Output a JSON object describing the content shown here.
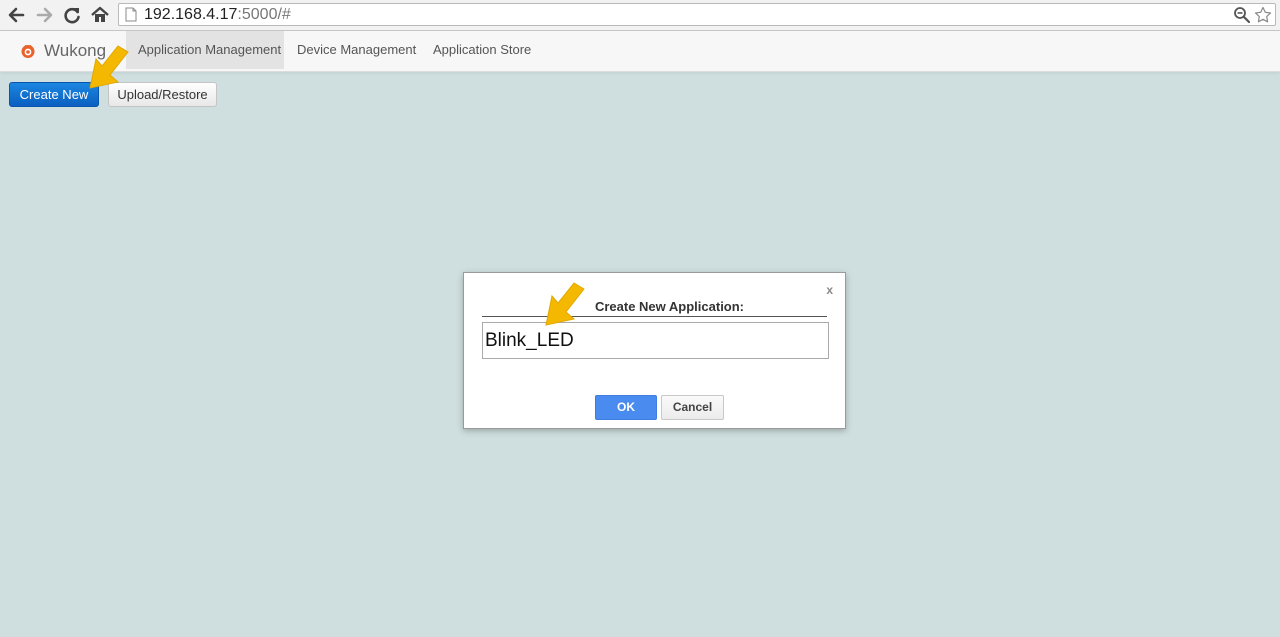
{
  "browser": {
    "url_host": "192.168.4.17",
    "url_rest": ":5000/#",
    "back_icon": "back-arrow-icon",
    "forward_icon": "forward-arrow-icon",
    "reload_icon": "reload-icon",
    "home_icon": "home-icon",
    "zoom_icon": "zoom-icon",
    "bookmark_icon": "star-icon"
  },
  "navbar": {
    "brand": "Wukong",
    "tabs": [
      {
        "label": "Application Management",
        "active": true
      },
      {
        "label": "Device Management",
        "active": false
      },
      {
        "label": "Application Store",
        "active": false
      }
    ]
  },
  "toolbar": {
    "create_label": "Create New",
    "upload_label": "Upload/Restore"
  },
  "dialog": {
    "close_label": "x",
    "title": "Create New Application:",
    "input_value": "Blink_LED",
    "ok_label": "OK",
    "cancel_label": "Cancel"
  },
  "colors": {
    "page_bg": "#cfdfdf",
    "primary": "#0b5fc0",
    "ok": "#4a8bf0",
    "annotation_arrow": "#f5b800"
  }
}
